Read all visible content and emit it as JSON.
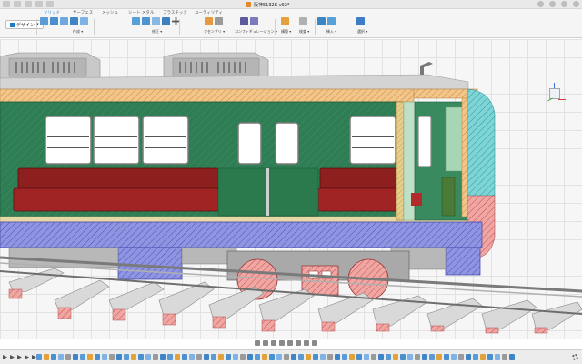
{
  "window": {
    "title": "阪神5132K v92*"
  },
  "workspace": {
    "label": "デザイン"
  },
  "tabs": [
    {
      "label": "ソリッド",
      "active": true
    },
    {
      "label": "サーフェス",
      "active": false
    },
    {
      "label": "メッシュ",
      "active": false
    },
    {
      "label": "シート メタル",
      "active": false
    },
    {
      "label": "プラスチック",
      "active": false
    },
    {
      "label": "ユーティリティ",
      "active": false
    }
  ],
  "toolbar_groups": [
    {
      "label": "作成 ▾"
    },
    {
      "label": "修正 ▾"
    },
    {
      "label": "アセンブリ ▾"
    },
    {
      "label": "コンフィギュレーション ▾"
    },
    {
      "label": "構築 ▾"
    },
    {
      "label": "検査 ▾"
    },
    {
      "label": "挿入 ▾"
    },
    {
      "label": "選択 ▾"
    }
  ],
  "colors": {
    "body_green": "#2f7d54",
    "window_frame": "#d9d9d9",
    "seat_red": "#8e1f1f",
    "section_hatch_orange": "#f2c68a",
    "section_hatch_blue": "#8f95e0",
    "section_hatch_pink": "#f0a7a4",
    "section_hatch_teal": "#7fd4d6",
    "accent": "#1b7ac9"
  },
  "icons": {
    "workspace": "grid-icon",
    "viewcube": "viewcube-icon",
    "navigation": "orbit-icon",
    "timeline_settings": "gear-icon"
  }
}
